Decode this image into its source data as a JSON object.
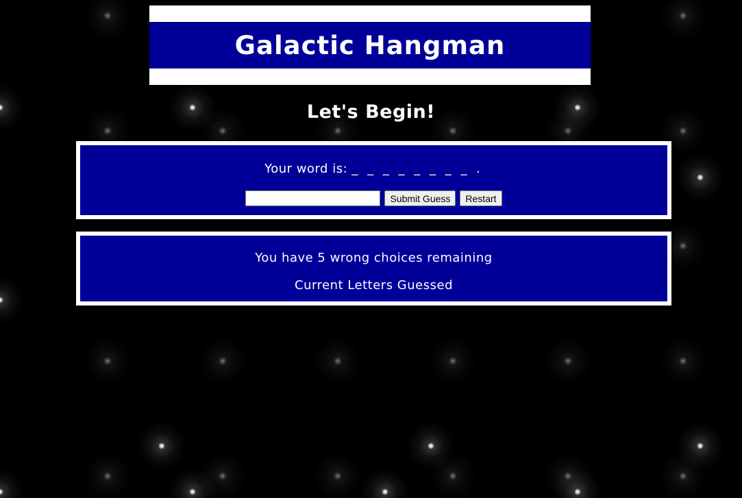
{
  "header": {
    "title": "Galactic Hangman",
    "subtitle": "Let's Begin!"
  },
  "game": {
    "word_label": "Your word is:",
    "word_blanks": "_ _ _ _ _ _ _ _ .",
    "guess_input": {
      "value": "",
      "placeholder": ""
    },
    "submit_label": "Submit Guess",
    "restart_label": "Restart"
  },
  "status": {
    "remaining_text": "You have 5 wrong choices remaining",
    "guessed_label": "Current Letters Guessed"
  },
  "colors": {
    "background": "#000000",
    "panel": "#000099",
    "border": "#ffffff",
    "text": "#ffffff"
  }
}
